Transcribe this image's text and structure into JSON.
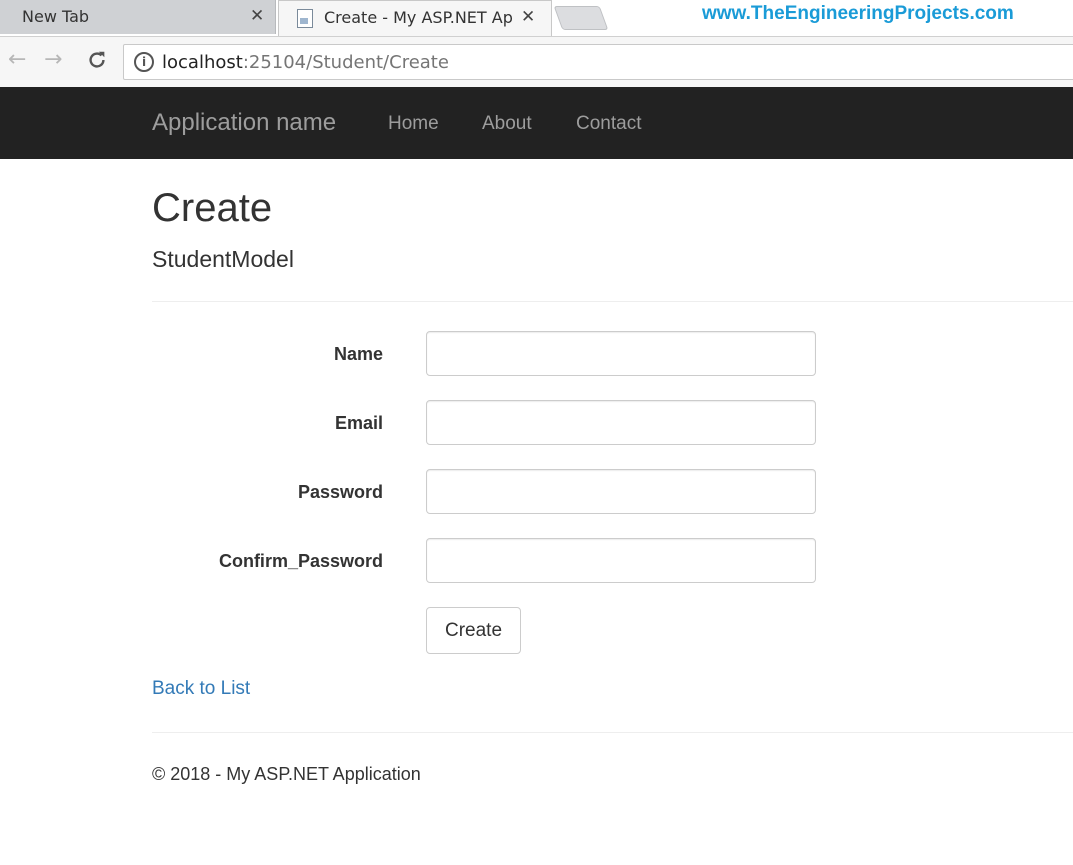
{
  "browser": {
    "tabs": [
      {
        "title": "New Tab",
        "close": "✕"
      },
      {
        "title": "Create - My ASP.NET App",
        "close": "✕"
      }
    ],
    "nav": {
      "back": "←",
      "forward": "→",
      "reload": "⟳"
    },
    "info_icon": "i",
    "url_host": "localhost",
    "url_rest": ":25104/Student/Create"
  },
  "watermark": "www.TheEngineeringProjects.com",
  "navbar": {
    "brand": "Application name",
    "links": [
      "Home",
      "About",
      "Contact"
    ]
  },
  "page": {
    "title": "Create",
    "subtitle": "StudentModel"
  },
  "form": {
    "fields": [
      {
        "label": "Name",
        "value": ""
      },
      {
        "label": "Email",
        "value": ""
      },
      {
        "label": "Password",
        "value": ""
      },
      {
        "label": "Confirm_Password",
        "value": ""
      }
    ],
    "submit_label": "Create"
  },
  "back_link": "Back to List",
  "footer": "© 2018 - My ASP.NET Application",
  "colors": {
    "navbar_bg": "#222222",
    "link": "#337ab7",
    "watermark": "#1a9bd7"
  }
}
